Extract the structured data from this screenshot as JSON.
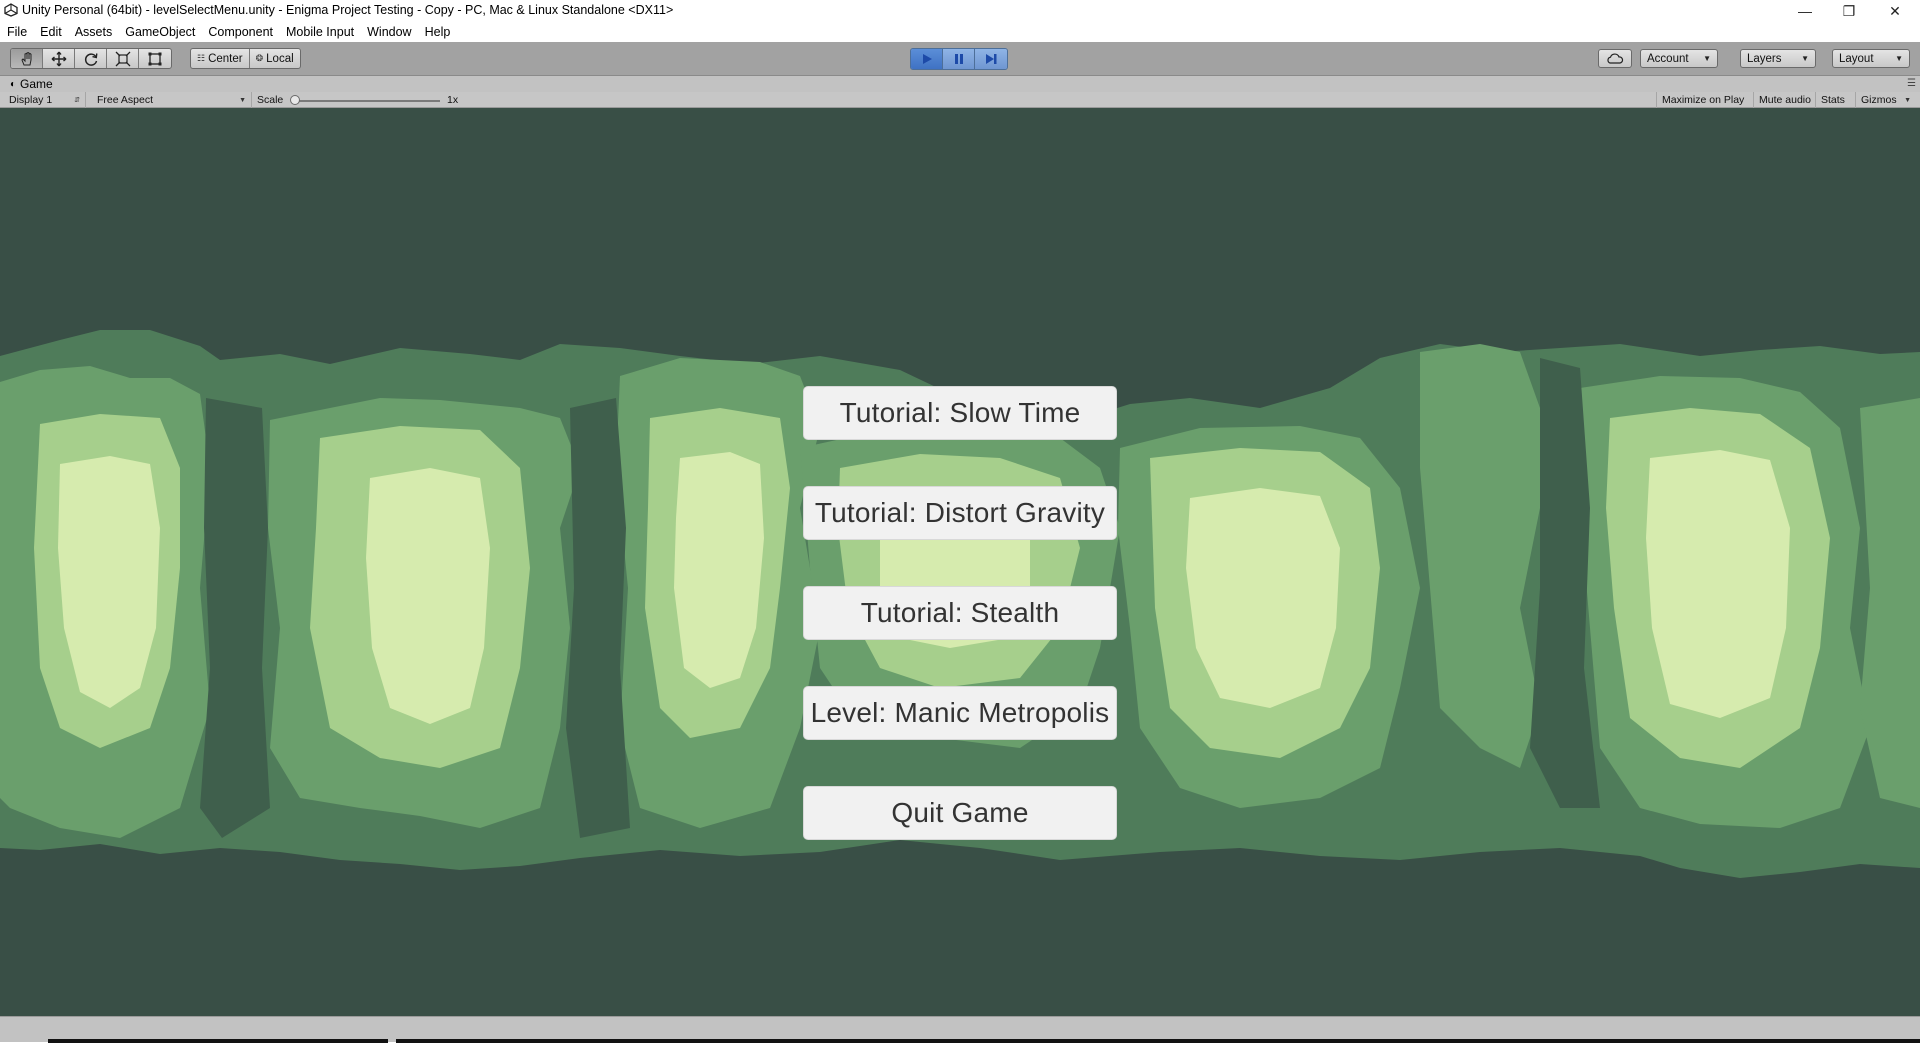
{
  "window": {
    "title": "Unity Personal (64bit) - levelSelectMenu.unity - Enigma Project Testing - Copy - PC, Mac & Linux Standalone <DX11>",
    "minimize_glyph": "—",
    "maximize_glyph": "❐",
    "close_glyph": "✕"
  },
  "menubar": {
    "items": [
      "File",
      "Edit",
      "Assets",
      "GameObject",
      "Component",
      "Mobile Input",
      "Window",
      "Help"
    ]
  },
  "toolbar": {
    "transform_tools": [
      "hand-icon",
      "move-icon",
      "rotate-icon",
      "scale-icon",
      "rect-icon"
    ],
    "pivot_center_label": "Center",
    "pivot_local_label": "Local",
    "account_label": "Account",
    "layers_label": "Layers",
    "layout_label": "Layout"
  },
  "game_tab": {
    "label": "Game",
    "display_label": "Display 1",
    "aspect_label": "Free Aspect",
    "scale_label": "Scale",
    "scale_value": "1x",
    "scale_level": 0,
    "maximize_label": "Maximize on Play",
    "mute_label": "Mute audio",
    "stats_label": "Stats",
    "gizmos_label": "Gizmos"
  },
  "game_menu": {
    "buttons": [
      "Tutorial: Slow Time",
      "Tutorial: Distort Gravity",
      "Tutorial: Stealth",
      "Level: Manic Metropolis",
      "Quit Game"
    ]
  },
  "colors": {
    "background": "#394f46",
    "forest_dark": "#4c7a58",
    "forest_mid": "#6fa373",
    "forest_light": "#a9d08e",
    "forest_pale": "#d8ecb0",
    "button_face": "#f1f1f1",
    "play_blue": "#5b8ed8"
  }
}
